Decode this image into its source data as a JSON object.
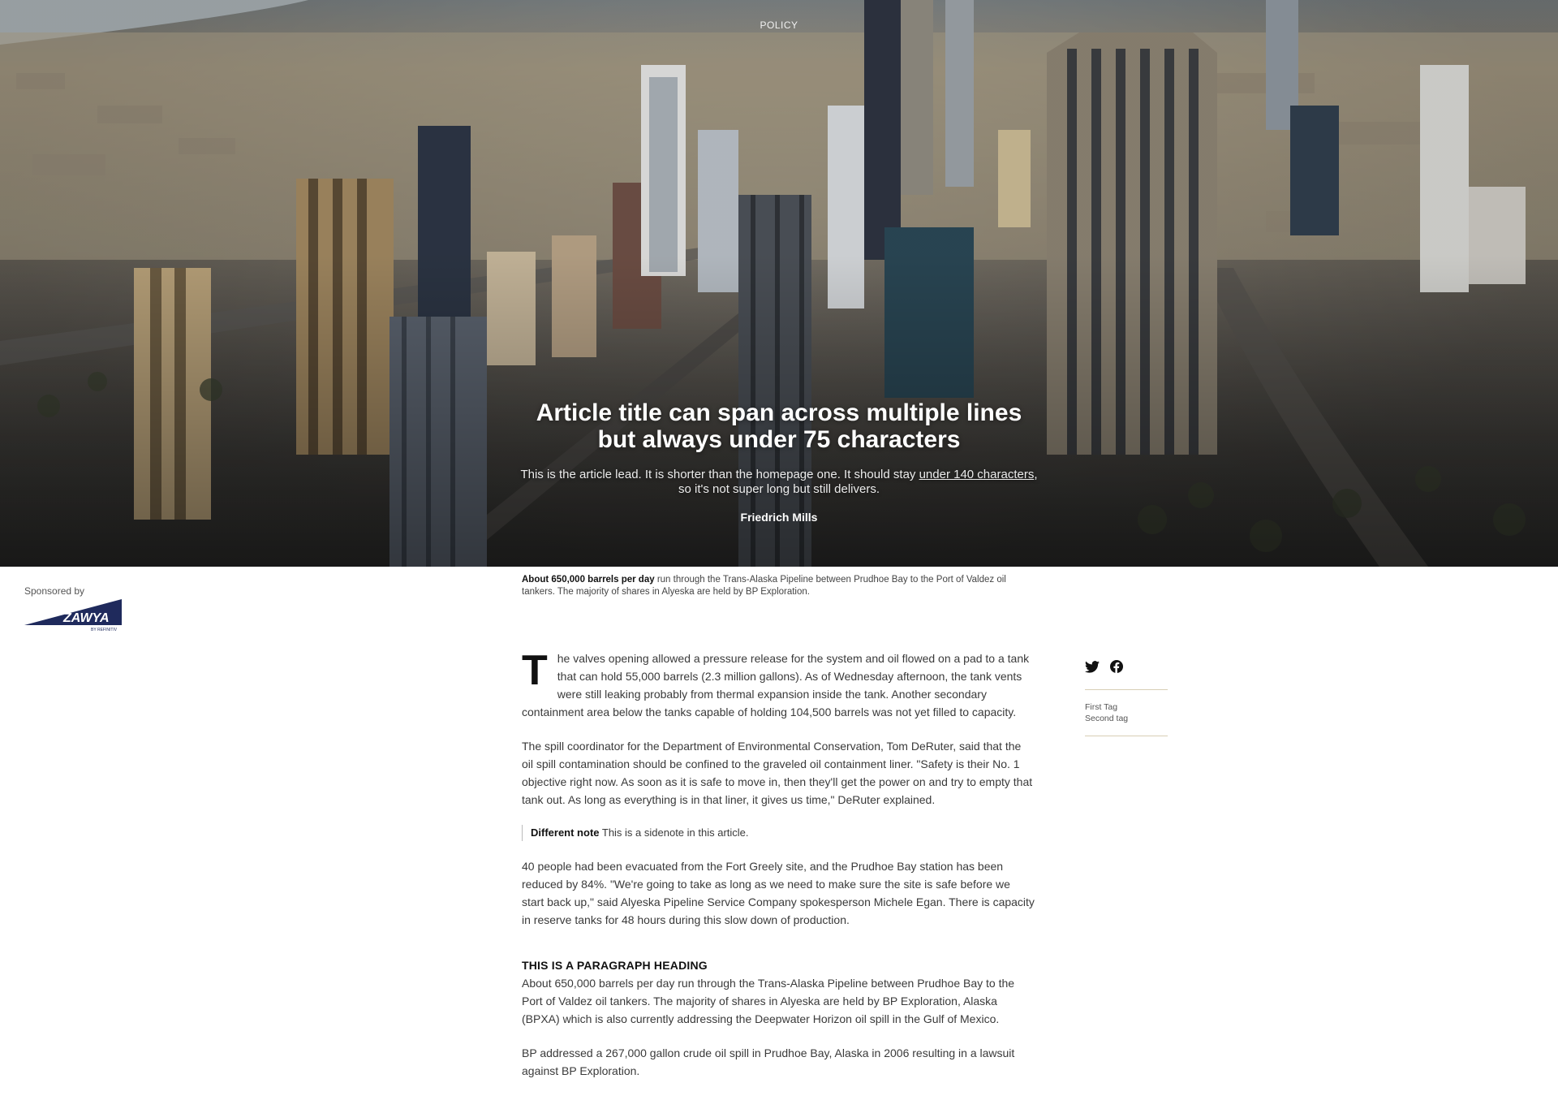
{
  "hero": {
    "category": "POLICY",
    "title": "Article title can span across multiple lines but always under 75 characters",
    "lead_before": "This is the article lead. It is shorter than the homepage one. It should stay ",
    "lead_link": "under 140 characters",
    "lead_after": ", so it's not super long but still delivers.",
    "author": "Friedrich Mills"
  },
  "caption": {
    "bold": "About 650,000 barrels per day",
    "text": " run through the Trans-Alaska Pipeline between Prudhoe Bay to the Port of Valdez oil tankers. The majority of shares in Alyeska are held by BP Exploration."
  },
  "sponsor": {
    "label": "Sponsored by",
    "logo_text": "ZAWYA",
    "logo_subtext": "BY REFINITIV",
    "logo_color": "#1f2a5c"
  },
  "article": {
    "dropcap": "T",
    "p1": "he valves opening allowed a pressure release for the system and oil flowed on a pad to a tank that can hold 55,000 barrels (2.3 million gallons). As of Wednesday afternoon, the tank vents were still leaking probably from thermal expansion inside the tank. Another secondary containment area below the tanks capable of holding 104,500 barrels was not yet filled to capacity.",
    "p2": "The spill coordinator for the Department of Environmental Conservation, Tom DeRuter, said that the oil spill contamination should be confined to the graveled oil containment liner. \"Safety is their No. 1 objective right now. As soon as it is safe to move in, then they'll get the power on and try to empty that tank out. As long as everything is in that liner, it gives us time,\" DeRuter explained.",
    "sidenote_label": "Different note",
    "sidenote_text": " This is a sidenote in this article.",
    "p3": "40 people had been evacuated from the Fort Greely site, and the Prudhoe Bay station has been reduced by 84%. \"We're going to take as long as we need to make sure the site is safe before we start back up,\" said Alyeska Pipeline Service Company spokesperson Michele Egan. There is capacity in reserve tanks for 48 hours during this slow down of production.",
    "heading": "THIS IS A PARAGRAPH HEADING",
    "p4": "About 650,000 barrels per day run through the Trans-Alaska Pipeline between Prudhoe Bay to the Port of Valdez oil tankers. The majority of shares in Alyeska are held by BP Exploration, Alaska (BPXA) which is also currently addressing the Deepwater Horizon oil spill in the Gulf of Mexico.",
    "p5": "BP addressed a 267,000 gallon crude oil spill in Prudhoe Bay, Alaska in 2006 resulting in a lawsuit against BP Exploration."
  },
  "share": {
    "icons": [
      "twitter-icon",
      "facebook-icon"
    ],
    "tags": [
      "First Tag",
      "Second tag"
    ],
    "divider_color": "#d8cfb6"
  }
}
